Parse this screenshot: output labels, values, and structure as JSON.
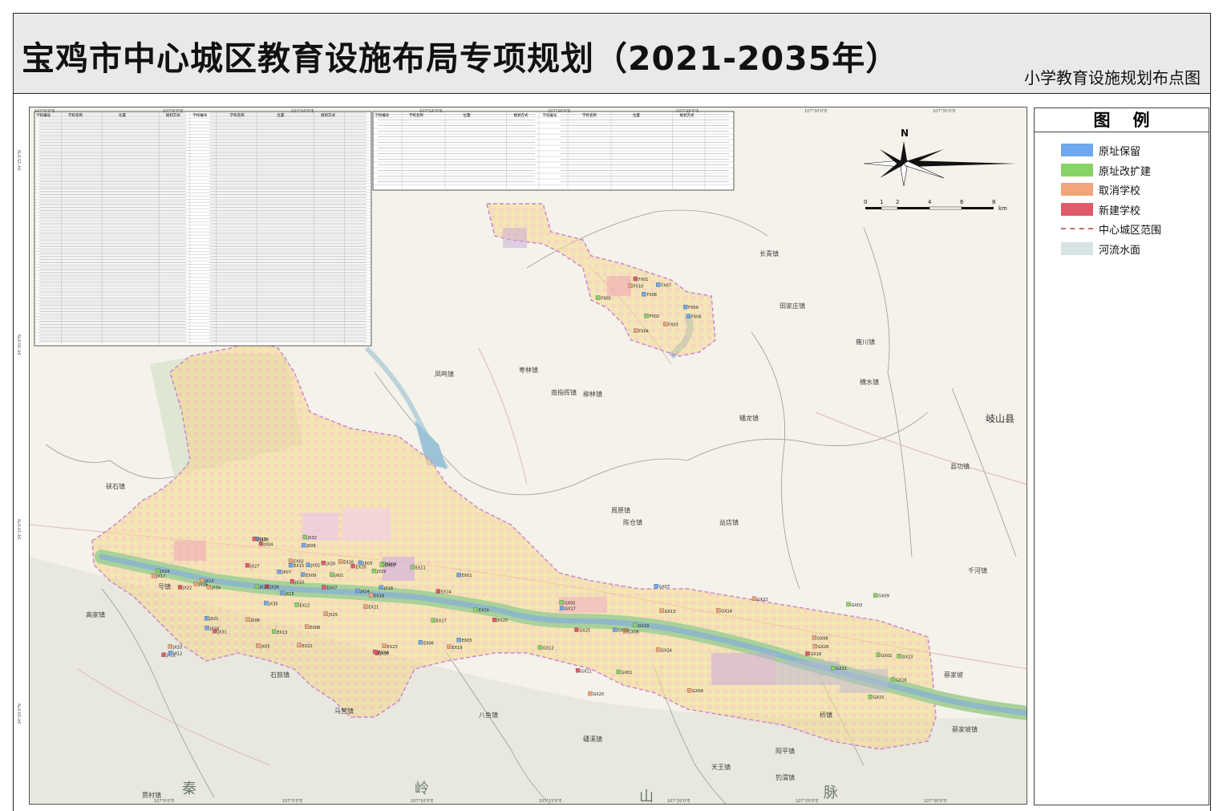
{
  "header": {
    "title": "宝鸡市中心城区教育设施布局专项规划（2021-2035年）",
    "subtitle": "小学教育设施规划布点图"
  },
  "legend": {
    "title": "图例",
    "items": [
      {
        "label": "原址保留",
        "color": "#6ea8ee",
        "type": "fill"
      },
      {
        "label": "原址改扩建",
        "color": "#88d366",
        "type": "fill"
      },
      {
        "label": "取消学校",
        "color": "#f2a47a",
        "type": "fill"
      },
      {
        "label": "新建学校",
        "color": "#e05a6a",
        "type": "fill"
      },
      {
        "label": "中心城区范围",
        "color": "#c07070",
        "type": "dash"
      },
      {
        "label": "河流水面",
        "color": "#d6e4e6",
        "type": "fill"
      }
    ]
  },
  "map": {
    "compass_label": "N",
    "scale_ticks": [
      "0",
      "1",
      "2",
      "4",
      "6",
      "8"
    ],
    "scale_unit": "km",
    "county_label": "岐山县",
    "top_ticks": [
      "107°0'0\"E",
      "107°5'0\"E",
      "107°10'0\"E",
      "107°15'0\"E",
      "107°20'0\"E",
      "107°25'0\"E",
      "107°30'0\"E",
      "107°35'0\"E"
    ],
    "bottom_ticks": [
      "107°0'0\"E",
      "107°5'0\"E",
      "107°10'0\"E",
      "107°15'0\"E",
      "107°20'0\"E",
      "107°25'0\"E",
      "107°30'0\"E"
    ],
    "left_ticks": [
      "34°25'0\"N",
      "34°20'0\"N",
      "34°15'0\"N",
      "34°10'0\"N"
    ],
    "places": [
      {
        "name": "蔡家坡镇"
      },
      {
        "name": "桥镇"
      },
      {
        "name": "阳平镇"
      },
      {
        "name": "石鼓镇"
      },
      {
        "name": "马营镇"
      },
      {
        "name": "八鱼镇"
      },
      {
        "name": "磻溪镇"
      },
      {
        "name": "天王镇"
      },
      {
        "name": "钓渭镇"
      },
      {
        "name": "高家镇"
      },
      {
        "name": "硖石镇"
      },
      {
        "name": "蟠龙镇"
      },
      {
        "name": "陈仓镇"
      },
      {
        "name": "县功镇"
      },
      {
        "name": "周原镇"
      },
      {
        "name": "蔡家坡"
      },
      {
        "name": "益店镇"
      },
      {
        "name": "枣林镇"
      },
      {
        "name": "凤鸣镇"
      },
      {
        "name": "雍川镇"
      },
      {
        "name": "横水镇"
      },
      {
        "name": "田家庄镇"
      },
      {
        "name": "长青镇"
      },
      {
        "name": "柳林镇"
      },
      {
        "name": "南指挥镇"
      },
      {
        "name": "号镇"
      },
      {
        "name": "贾村镇"
      },
      {
        "name": "千河镇"
      }
    ],
    "mountain_labels": [
      "秦",
      "岭",
      "山",
      "脉"
    ],
    "school_codes": [
      "JX35",
      "JX34",
      "JX33",
      "JX27",
      "JX32",
      "JX21",
      "JX15",
      "JX11",
      "JX22",
      "JX16",
      "JX02",
      "JX18",
      "JX07",
      "JX01",
      "JX12",
      "JX14",
      "JX10",
      "JX09",
      "JX08",
      "JX06",
      "JX19",
      "JX26",
      "JX28",
      "JX29",
      "JX31",
      "JX30",
      "JX25",
      "JX24",
      "JX23",
      "JX20",
      "JX17",
      "JX13",
      "JX05",
      "JX04",
      "JX03",
      "EX08",
      "EX06",
      "EX01",
      "EX02",
      "EX05",
      "EX04",
      "EX03",
      "EX07",
      "EX09",
      "EX11",
      "EX12",
      "EX13",
      "EX14",
      "EX17",
      "EX10",
      "EX15",
      "EX16",
      "EX18",
      "EX20",
      "EX22",
      "EX23",
      "EX24",
      "EX21",
      "EX19",
      "EX25",
      "FX01",
      "FX02",
      "FX03",
      "FX04",
      "FX05",
      "FX06",
      "FX07",
      "FX08",
      "FX09",
      "FX10",
      "GX01",
      "GX02",
      "GX03",
      "GX04",
      "GX05",
      "GX06",
      "GX07",
      "GX08",
      "GX09",
      "GX10",
      "GX11",
      "GX12",
      "GX13",
      "GX14",
      "GX15",
      "GX16",
      "GX17",
      "GX18",
      "GX19",
      "GX20",
      "GX21",
      "GX22",
      "GX23",
      "GX24",
      "GX25",
      "GX26"
    ],
    "table1": {
      "headers": [
        "学校编号",
        "学校名称",
        "位置",
        "规划方式",
        "学校编号",
        "学校名称",
        "位置",
        "规划方式"
      ]
    },
    "table2": {
      "headers": [
        "学校编号",
        "学校名称",
        "位置",
        "规划方式",
        "学校编号",
        "学校名称",
        "位置",
        "规划方式"
      ]
    }
  }
}
